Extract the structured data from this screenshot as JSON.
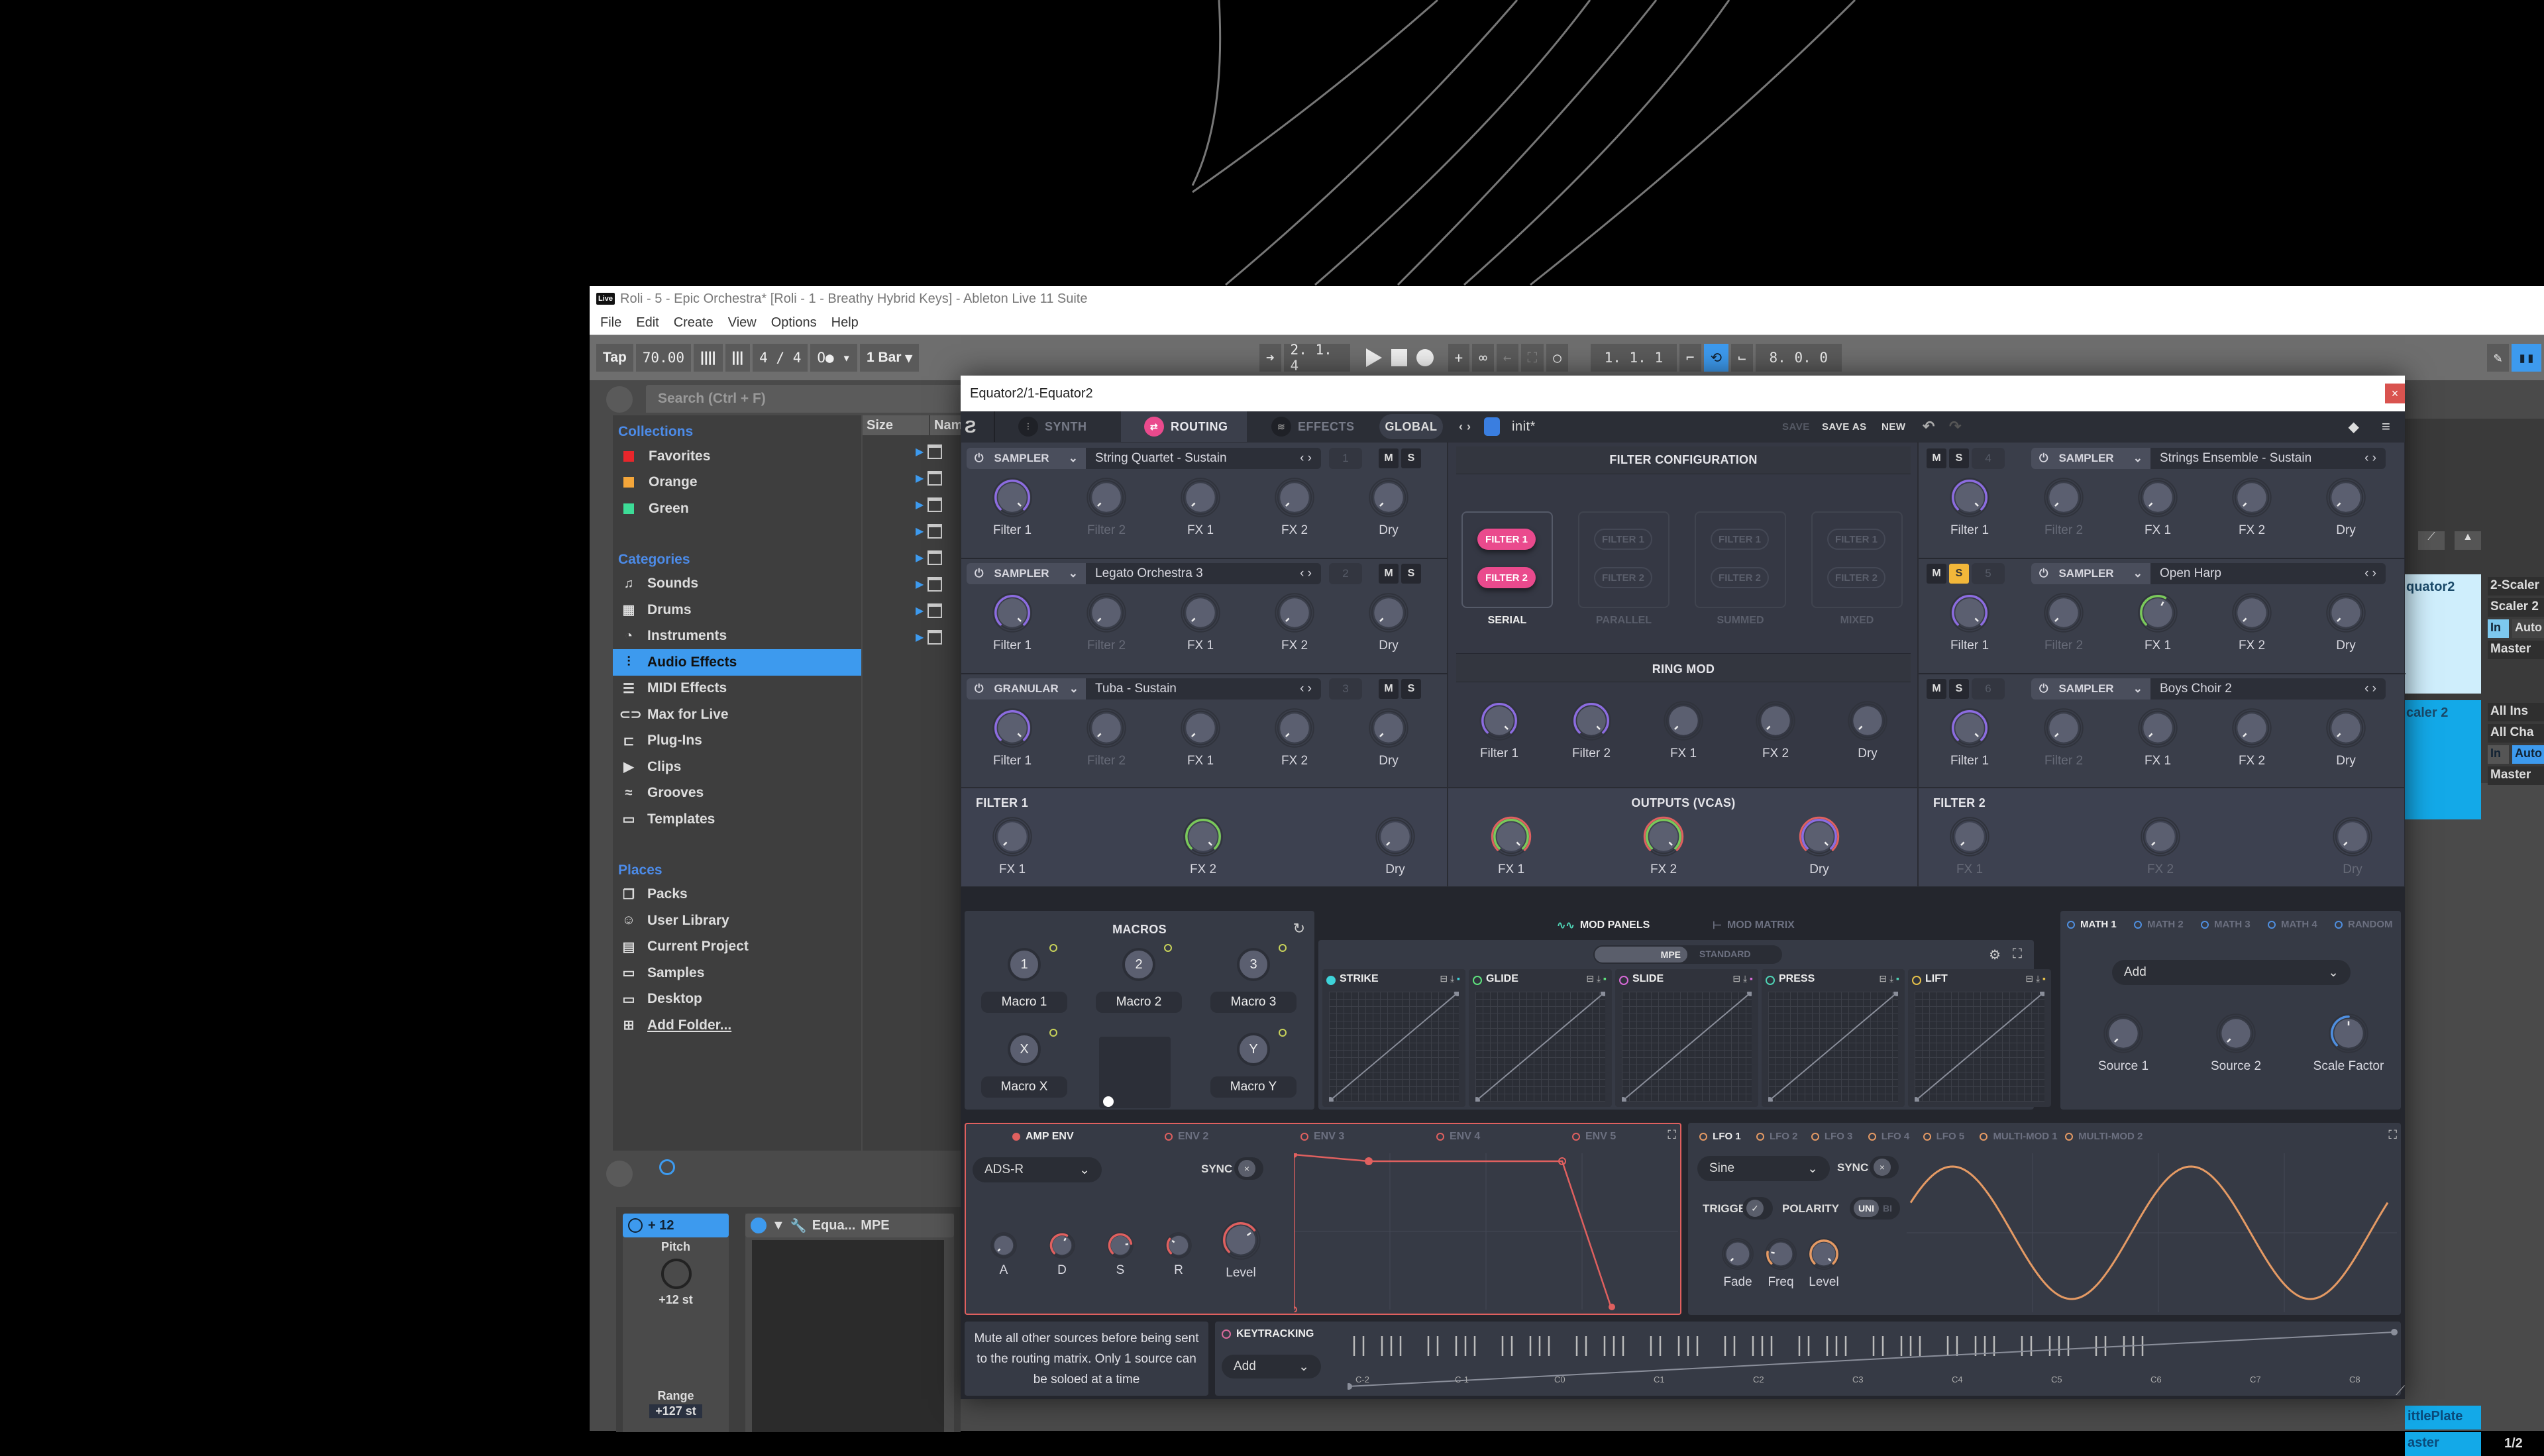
{
  "ableton": {
    "title": "Roli - 5 - Epic Orchestra*  [Roli - 1 - Breathy Hybrid Keys] - Ableton Live 11 Suite",
    "logo": "Live",
    "menu": [
      "File",
      "Edit",
      "Create",
      "View",
      "Options",
      "Help"
    ],
    "transport": {
      "tap": "Tap",
      "tempo": "70.00",
      "time_signature": "4 / 4",
      "metronome": "O●",
      "quantize": "1 Bar",
      "arrangement_position": "2.  1.  4",
      "loop_start": "1.  1.  1",
      "loop_length": "8.  0.  0"
    },
    "browser": {
      "search_placeholder": "Search (Ctrl + F)",
      "collections_label": "Collections",
      "collections": [
        {
          "label": "Favorites",
          "color": "#e8262b"
        },
        {
          "label": "Orange",
          "color": "#f4a63a"
        },
        {
          "label": "Green",
          "color": "#3ddc97"
        }
      ],
      "categories_label": "Categories",
      "categories": [
        {
          "label": "Sounds",
          "icon": "music-note-icon"
        },
        {
          "label": "Drums",
          "icon": "drum-grid-icon"
        },
        {
          "label": "Instruments",
          "icon": "instrument-icon"
        },
        {
          "label": "Audio Effects",
          "icon": "audio-effects-icon",
          "selected": true
        },
        {
          "label": "MIDI Effects",
          "icon": "midi-effects-icon"
        },
        {
          "label": "Max for Live",
          "icon": "max-for-live-icon"
        },
        {
          "label": "Plug-Ins",
          "icon": "plugin-icon"
        },
        {
          "label": "Clips",
          "icon": "clip-icon"
        },
        {
          "label": "Grooves",
          "icon": "groove-icon"
        },
        {
          "label": "Templates",
          "icon": "template-icon"
        }
      ],
      "places_label": "Places",
      "places": [
        {
          "label": "Packs",
          "icon": "packs-icon"
        },
        {
          "label": "User Library",
          "icon": "user-icon"
        },
        {
          "label": "Current Project",
          "icon": "project-icon"
        },
        {
          "label": "Samples",
          "icon": "folder-icon"
        },
        {
          "label": "Desktop",
          "icon": "folder-icon"
        },
        {
          "label": "Add Folder...",
          "icon": "add-folder-icon"
        }
      ],
      "columns": {
        "size": "Size",
        "name": "Name"
      }
    },
    "device_chain": {
      "pitch_device": {
        "title": "+ 12",
        "param_label": "Pitch",
        "param_value": "+12 st",
        "range_label": "Range",
        "range_value": "+127 st"
      },
      "equator_device": {
        "title": "Equa...",
        "badge": "MPE"
      }
    },
    "tracks": [
      {
        "name": "quator2",
        "input": "2-Scaler",
        "channel": "Scaler 2",
        "monitor": [
          "In",
          "Auto"
        ],
        "output": "Master"
      },
      {
        "name": "caler 2",
        "input": "All Ins",
        "channel": "All Cha",
        "monitor": [
          "In",
          "Auto"
        ],
        "output": "Master"
      }
    ],
    "returns": [
      {
        "name": "ittlePlate"
      },
      {
        "name": "aster",
        "value": "1/2"
      }
    ]
  },
  "equator": {
    "window_title": "Equator2/1-Equator2",
    "tabs": [
      {
        "label": "SYNTH",
        "active": false
      },
      {
        "label": "ROUTING",
        "active": true
      },
      {
        "label": "EFFECTS",
        "active": false
      },
      {
        "label": "GLOBAL",
        "active": false
      }
    ],
    "preset": {
      "name": "init*",
      "save": "SAVE",
      "save_as": "SAVE AS",
      "new": "NEW"
    },
    "sources_left": [
      {
        "type": "SAMPLER",
        "name": "String Quartet - Sustain",
        "num": "1"
      },
      {
        "type": "SAMPLER",
        "name": "Legato Orchestra 3",
        "num": "2"
      },
      {
        "type": "GRANULAR",
        "name": "Tuba - Sustain",
        "num": "3"
      }
    ],
    "sources_right": [
      {
        "type": "SAMPLER",
        "name": "Strings Ensemble - Sustain",
        "num": "4",
        "solo": false
      },
      {
        "type": "SAMPLER",
        "name": "Open Harp",
        "num": "5",
        "solo": true
      },
      {
        "type": "SAMPLER",
        "name": "Boys Choir 2",
        "num": "6",
        "solo": false
      }
    ],
    "mute_label": "M",
    "solo_label": "S",
    "route_knobs": [
      "Filter 1",
      "Filter 2",
      "FX 1",
      "FX 2",
      "Dry"
    ],
    "filter1_section": {
      "title": "FILTER 1",
      "knobs": [
        "FX 1",
        "FX 2",
        "Dry"
      ]
    },
    "filter2_section": {
      "title": "FILTER 2",
      "knobs": [
        "FX 1",
        "FX 2",
        "Dry"
      ]
    },
    "filter_config": {
      "title": "FILTER CONFIGURATION",
      "filter1": "FILTER 1",
      "filter2": "FILTER 2",
      "modes": [
        "SERIAL",
        "PARALLEL",
        "SUMMED",
        "MIXED"
      ],
      "selected": "SERIAL"
    },
    "ring_mod": {
      "title": "RING MOD",
      "knobs": [
        "Filter 1",
        "Filter 2",
        "FX 1",
        "FX 2",
        "Dry"
      ]
    },
    "outputs": {
      "title": "OUTPUTS (VCAS)",
      "knobs": [
        "FX 1",
        "FX 2",
        "Dry"
      ]
    },
    "macros": {
      "title": "MACROS",
      "knobs": [
        {
          "glyph": "1",
          "label": "Macro 1"
        },
        {
          "glyph": "2",
          "label": "Macro 2"
        },
        {
          "glyph": "3",
          "label": "Macro 3"
        },
        {
          "glyph": "X",
          "label": "Macro X"
        },
        {
          "glyph": "Y",
          "label": "Macro Y"
        }
      ]
    },
    "mod_tabs": {
      "panels": "MOD PANELS",
      "matrix": "MOD MATRIX"
    },
    "mpe_toggle": {
      "mpe": "MPE",
      "standard": "STANDARD"
    },
    "mpe_dims": [
      {
        "label": "STRIKE",
        "color": "#3ed3d9"
      },
      {
        "label": "GLIDE",
        "color": "#5ee27d"
      },
      {
        "label": "SLIDE",
        "color": "#d86ad8"
      },
      {
        "label": "PRESS",
        "color": "#4fd3b5"
      },
      {
        "label": "LIFT",
        "color": "#e5c04a"
      }
    ],
    "math": {
      "tabs": [
        "MATH 1",
        "MATH 2",
        "MATH 3",
        "MATH 4",
        "RANDOM"
      ],
      "mode": "Add",
      "knobs": [
        "Source 1",
        "Source 2",
        "Scale Factor"
      ]
    },
    "env": {
      "tabs": [
        "AMP ENV",
        "ENV 2",
        "ENV 3",
        "ENV 4",
        "ENV 5"
      ],
      "mode": "ADS-R",
      "sync": "SYNC",
      "knobs": [
        "A",
        "D",
        "S",
        "R",
        "Level"
      ]
    },
    "lfo": {
      "tabs": [
        "LFO 1",
        "LFO 2",
        "LFO 3",
        "LFO 4",
        "LFO 5",
        "MULTI-MOD 1",
        "MULTI-MOD 2"
      ],
      "shape": "Sine",
      "sync": "SYNC",
      "trigger": "TRIGGER",
      "polarity": "POLARITY",
      "polarity_options": [
        "UNI",
        "BI"
      ],
      "polarity_selected": "UNI",
      "knobs": [
        "Fade",
        "Freq",
        "Level"
      ]
    },
    "tooltip": "Mute all other sources before being sent to the routing matrix. Only 1 source can be soloed at a time",
    "keytracking": {
      "title": "KEYTRACKING",
      "mode": "Add",
      "notes": [
        "C-2",
        "C-1",
        "C0",
        "C1",
        "C2",
        "C3",
        "C4",
        "C5",
        "C6",
        "C7",
        "C8"
      ]
    },
    "colors": {
      "accent_pink": "#ea4a8d",
      "purple": "#8c6ce0",
      "green": "#7ac95a",
      "env_red": "#e0605f",
      "lfo_orange": "#e59a64",
      "blue": "#4f8fe0"
    }
  }
}
